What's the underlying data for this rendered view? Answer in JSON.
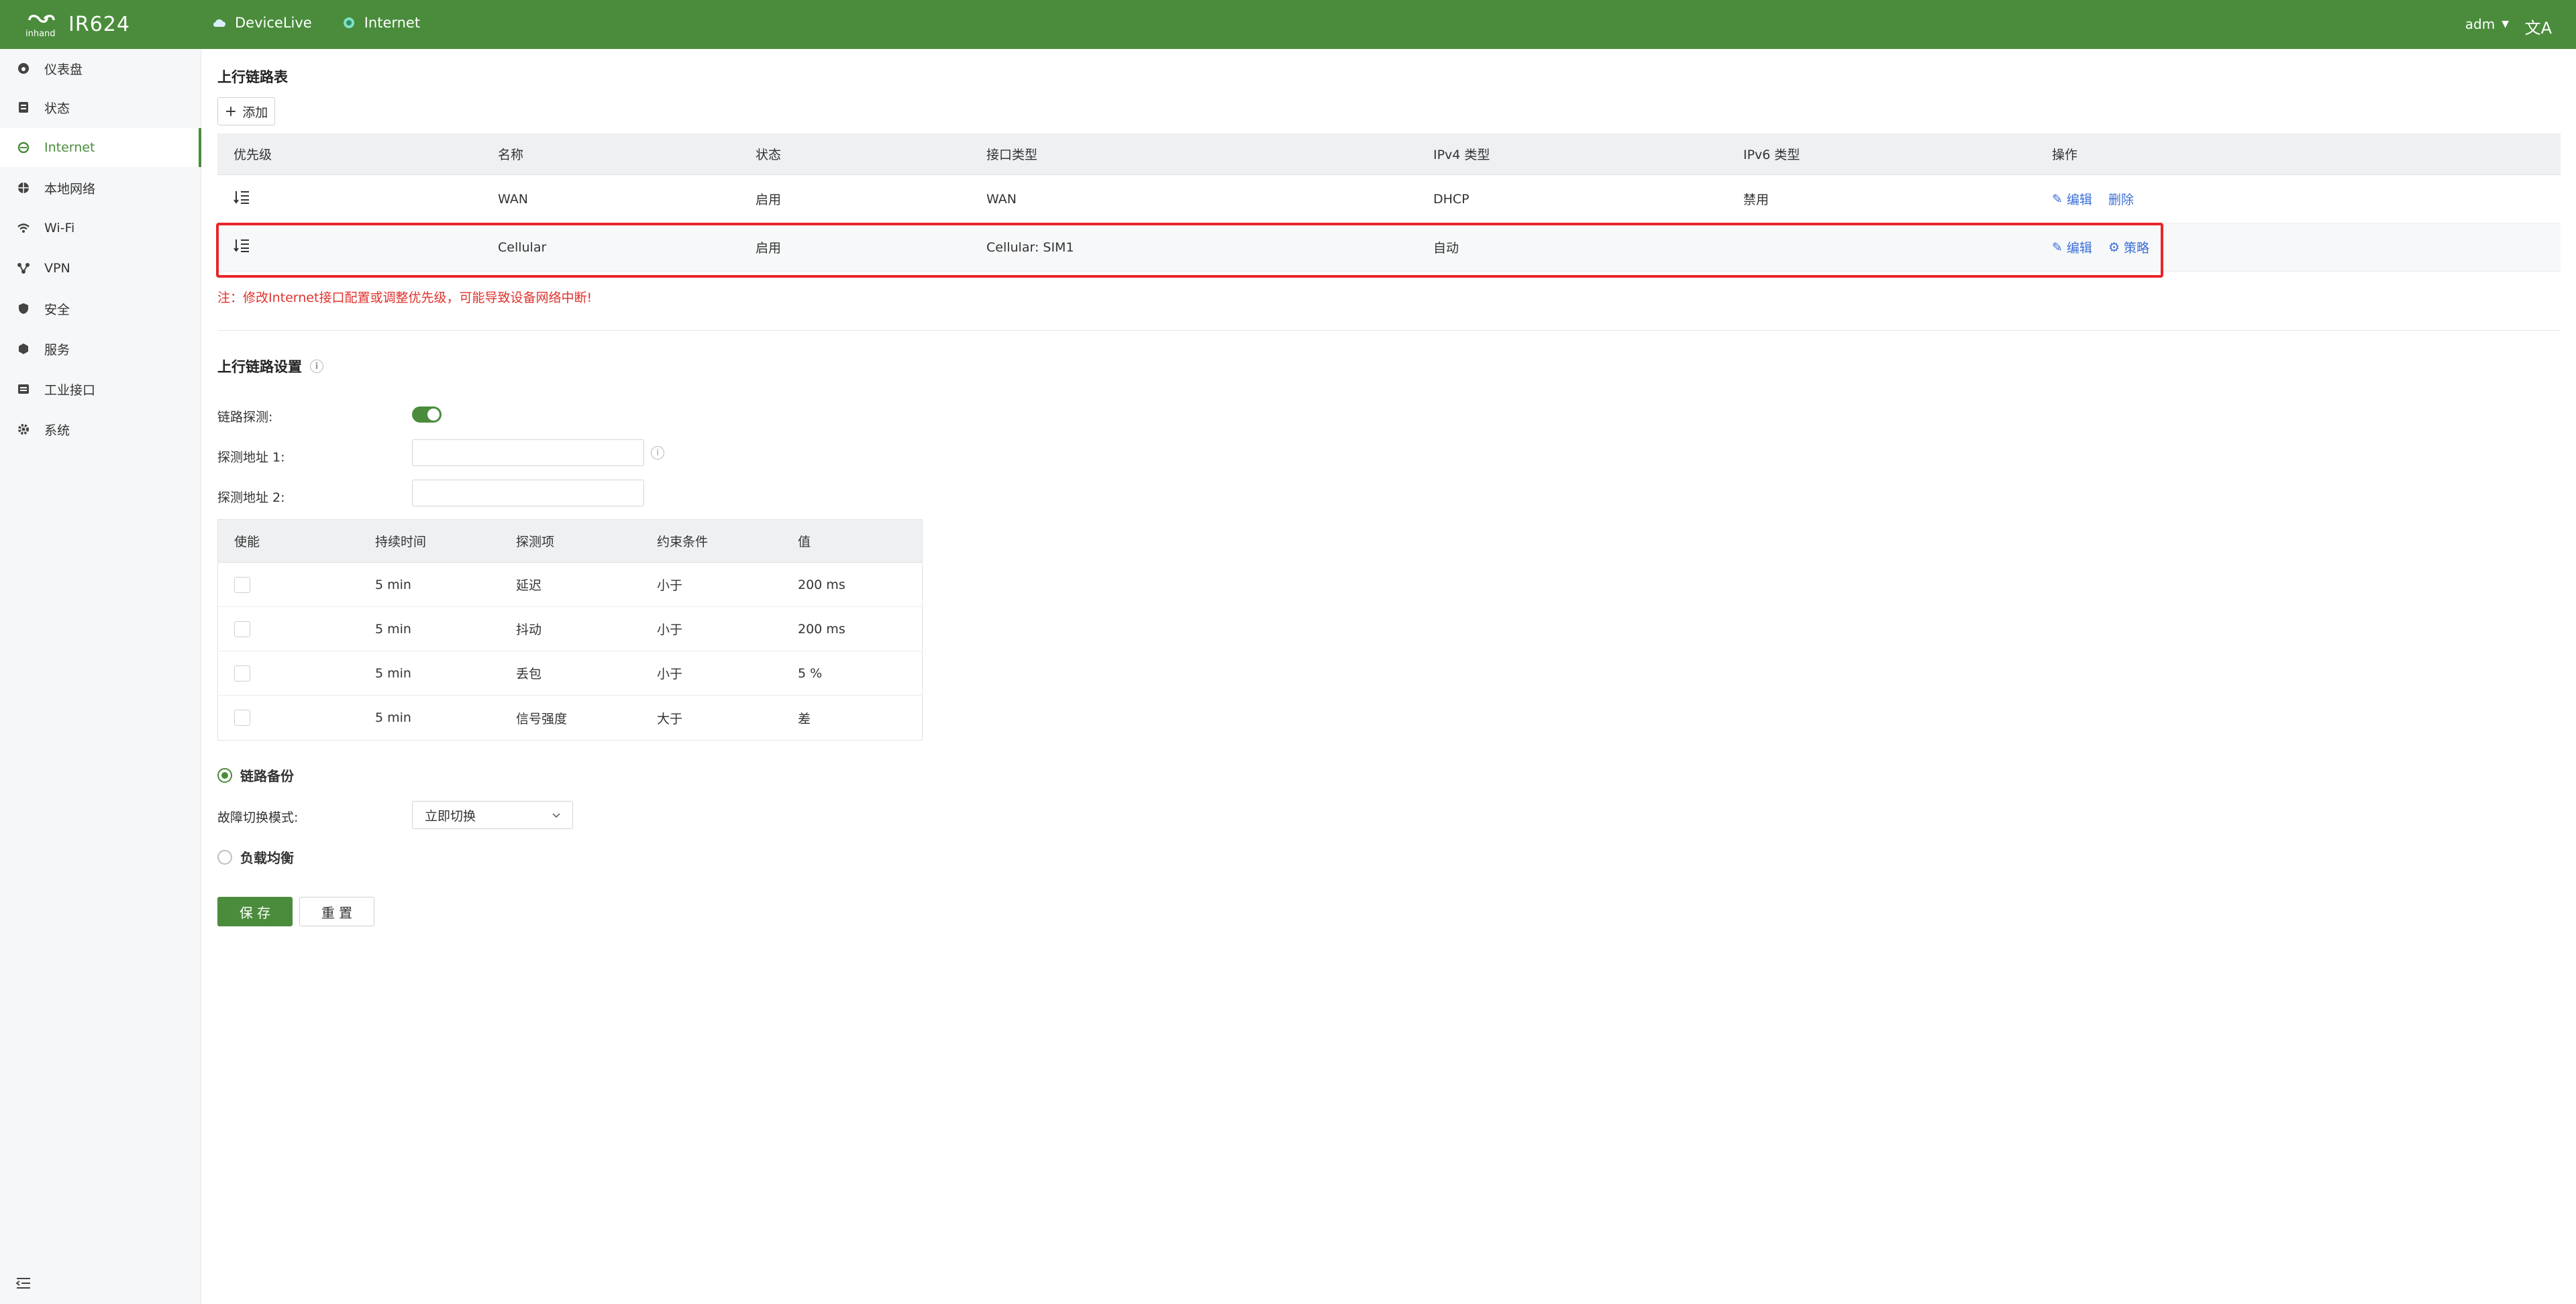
{
  "header": {
    "product": "IR624",
    "logo_small": "inhand",
    "nav": [
      {
        "label": "DeviceLive",
        "icon": "cloud-icon"
      },
      {
        "label": "Internet",
        "icon": "globe-icon"
      }
    ],
    "user": "adm",
    "lang_icon": "translate-icon"
  },
  "sidebar": {
    "items": [
      {
        "label": "仪表盘",
        "icon": "dashboard-icon"
      },
      {
        "label": "状态",
        "icon": "status-icon"
      },
      {
        "label": "Internet",
        "icon": "internet-icon",
        "active": true
      },
      {
        "label": "本地网络",
        "icon": "local-network-icon"
      },
      {
        "label": "Wi-Fi",
        "icon": "wifi-icon"
      },
      {
        "label": "VPN",
        "icon": "vpn-icon"
      },
      {
        "label": "安全",
        "icon": "shield-icon"
      },
      {
        "label": "服务",
        "icon": "service-icon"
      },
      {
        "label": "工业接口",
        "icon": "industrial-interface-icon"
      },
      {
        "label": "系统",
        "icon": "gear-icon"
      }
    ]
  },
  "uplink": {
    "title": "上行链路表",
    "add_label": "添加",
    "columns": [
      "优先级",
      "名称",
      "状态",
      "接口类型",
      "IPv4 类型",
      "IPv6 类型",
      "操作"
    ],
    "rows": [
      {
        "name": "WAN",
        "status": "启用",
        "iface": "WAN",
        "ipv4": "DHCP",
        "ipv6": "禁用",
        "op1": "编辑",
        "op2": "删除"
      },
      {
        "name": "Cellular",
        "status": "启用",
        "iface": "Cellular: SIM1",
        "ipv4": "自动",
        "ipv6": "",
        "op1": "编辑",
        "op2": "策略"
      }
    ],
    "note": "注：修改Internet接口配置或调整优先级，可能导致设备网络中断!"
  },
  "settings": {
    "title": "上行链路设置",
    "probe_label": "链路探测:",
    "probe_enabled": true,
    "addr1_label": "探测地址 1:",
    "addr2_label": "探测地址 2:",
    "addr1_value": "",
    "addr2_value": ""
  },
  "probe_table": {
    "columns": [
      "使能",
      "持续时间",
      "探测项",
      "约束条件",
      "值"
    ],
    "rows": [
      {
        "duration": "5 min",
        "item": "延迟",
        "cond": "小于",
        "value": "200 ms"
      },
      {
        "duration": "5 min",
        "item": "抖动",
        "cond": "小于",
        "value": "200 ms"
      },
      {
        "duration": "5 min",
        "item": "丢包",
        "cond": "小于",
        "value": "5 %"
      },
      {
        "duration": "5 min",
        "item": "信号强度",
        "cond": "大于",
        "value": "差"
      }
    ]
  },
  "mode": {
    "backup_label": "链路备份",
    "failover_label": "故障切换模式:",
    "failover_value": "立即切换",
    "balance_label": "负载均衡",
    "selected": "backup"
  },
  "actions": {
    "save": "保 存",
    "reset": "重 置"
  }
}
